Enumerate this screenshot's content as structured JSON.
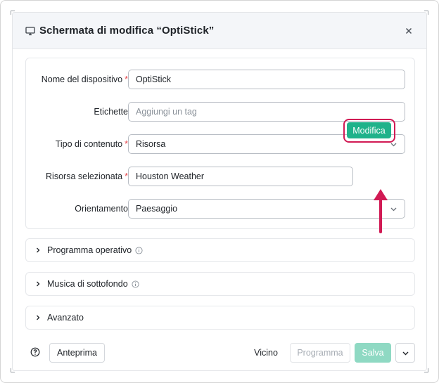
{
  "dialog": {
    "title": "Schermata di modifica  “OptiStick”",
    "icons": {
      "monitor": "monitor-icon",
      "close": "close-icon"
    }
  },
  "form": {
    "device_name": {
      "label": "Nome del dispositivo",
      "required": "*",
      "value": "OptiStick"
    },
    "tags": {
      "label": "Etichette",
      "placeholder": "Aggiungi un tag"
    },
    "content_type": {
      "label": "Tipo di contenuto",
      "required": "*",
      "value": "Risorsa"
    },
    "selected_resource": {
      "label": "Risorsa selezionata",
      "required": "*",
      "value": "Houston Weather",
      "edit_button": "Modifica"
    },
    "orientation": {
      "label": "Orientamento",
      "value": "Paesaggio"
    }
  },
  "sections": [
    {
      "title": "Programma operativo",
      "has_info": true
    },
    {
      "title": "Musica di sottofondo",
      "has_info": true
    },
    {
      "title": "Avanzato",
      "has_info": false
    }
  ],
  "footer": {
    "preview": "Anteprima",
    "close": "Vicino",
    "schedule": "Programma",
    "save": "Salva"
  },
  "colors": {
    "accent": "#1fb28a",
    "accent_disabled": "#8fd9c3",
    "highlight": "#d11a54",
    "required": "#e5484d"
  }
}
